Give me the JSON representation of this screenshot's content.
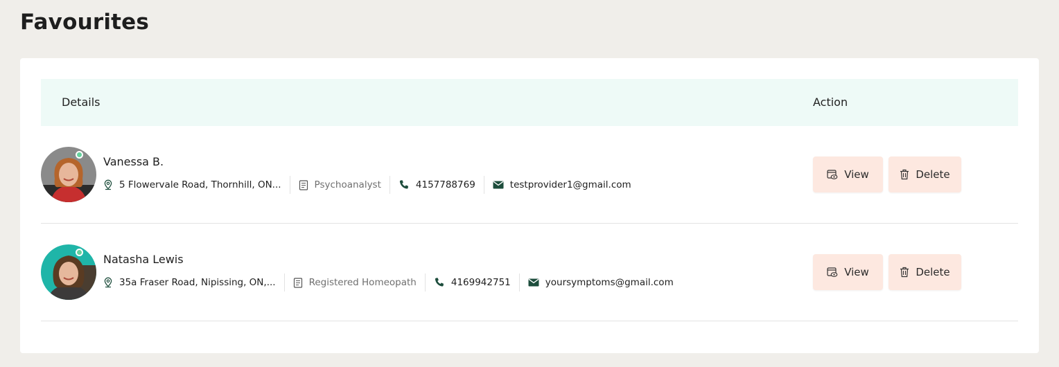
{
  "page": {
    "title": "Favourites"
  },
  "table": {
    "headers": {
      "details": "Details",
      "action": "Action"
    },
    "rows": [
      {
        "name": "Vanessa B.",
        "address": "5 Flowervale Road, Thornhill, ON...",
        "specialty": "Psychoanalyst",
        "phone": "4157788769",
        "email": "testprovider1@gmail.com",
        "online": true,
        "view_label": "View",
        "delete_label": "Delete"
      },
      {
        "name": "Natasha Lewis",
        "address": "35a Fraser Road, Nipissing, ON,...",
        "specialty": "Registered Homeopath",
        "phone": "4169942751",
        "email": "yoursymptoms@gmail.com",
        "online": true,
        "view_label": "View",
        "delete_label": "Delete"
      }
    ]
  },
  "colors": {
    "background": "#f0eeea",
    "header_bg": "#eefaf7",
    "button_bg": "#fde8e0",
    "icon_dark": "#1d4d3c",
    "online": "#66d19e"
  },
  "icons": [
    "location-pin-icon",
    "document-icon",
    "phone-icon",
    "envelope-icon",
    "view-eye-icon",
    "trash-icon"
  ]
}
